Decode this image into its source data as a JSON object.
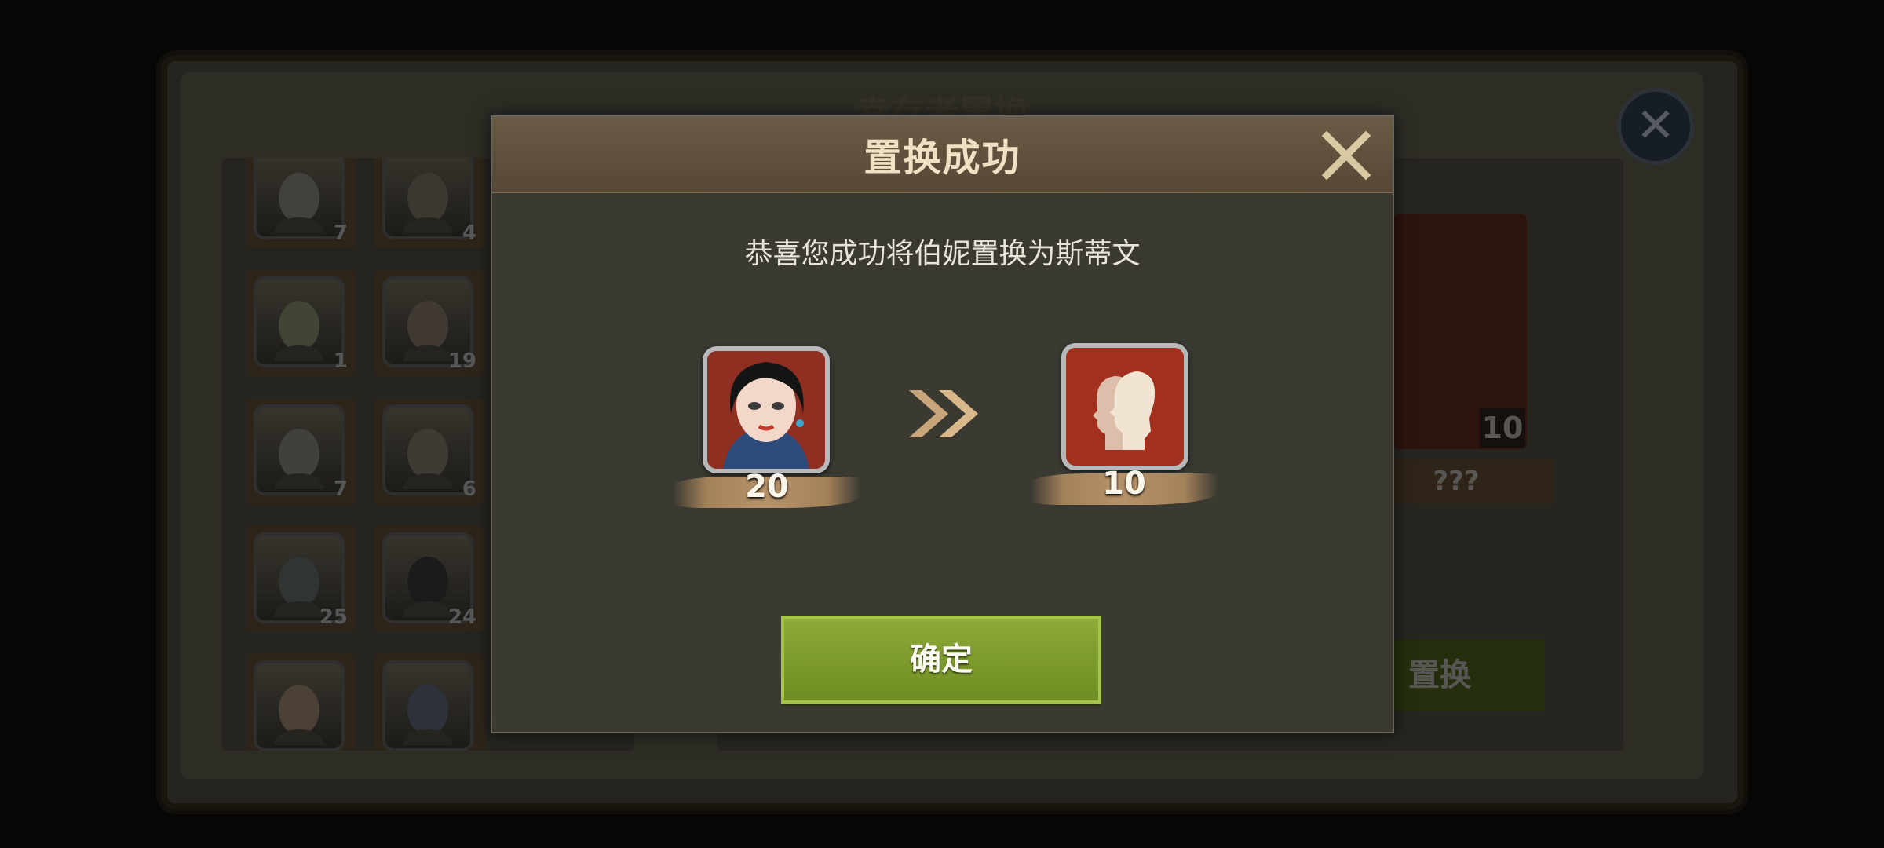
{
  "background": {
    "title": "幸存者置换",
    "roster": [
      {
        "count": "7"
      },
      {
        "count": "4"
      },
      {
        "count": "1"
      },
      {
        "count": "19"
      },
      {
        "count": "7"
      },
      {
        "count": "6"
      },
      {
        "count": "25"
      },
      {
        "count": "24"
      },
      {
        "count": ""
      },
      {
        "count": ""
      }
    ],
    "target_card": {
      "count": "10",
      "label": "???"
    },
    "replace_button_label": "置换"
  },
  "dialog": {
    "title": "置换成功",
    "message": "恭喜您成功将伯妮置换为斯蒂文",
    "from": {
      "count": "20",
      "icon": "female-hero-portrait"
    },
    "to": {
      "count": "10",
      "icon": "survivor-silhouettes-icon"
    },
    "confirm_label": "确定"
  },
  "colors": {
    "confirm_green": "#7c9a2c",
    "header_brown": "#5f5140",
    "portrait_red": "#a3301f"
  }
}
